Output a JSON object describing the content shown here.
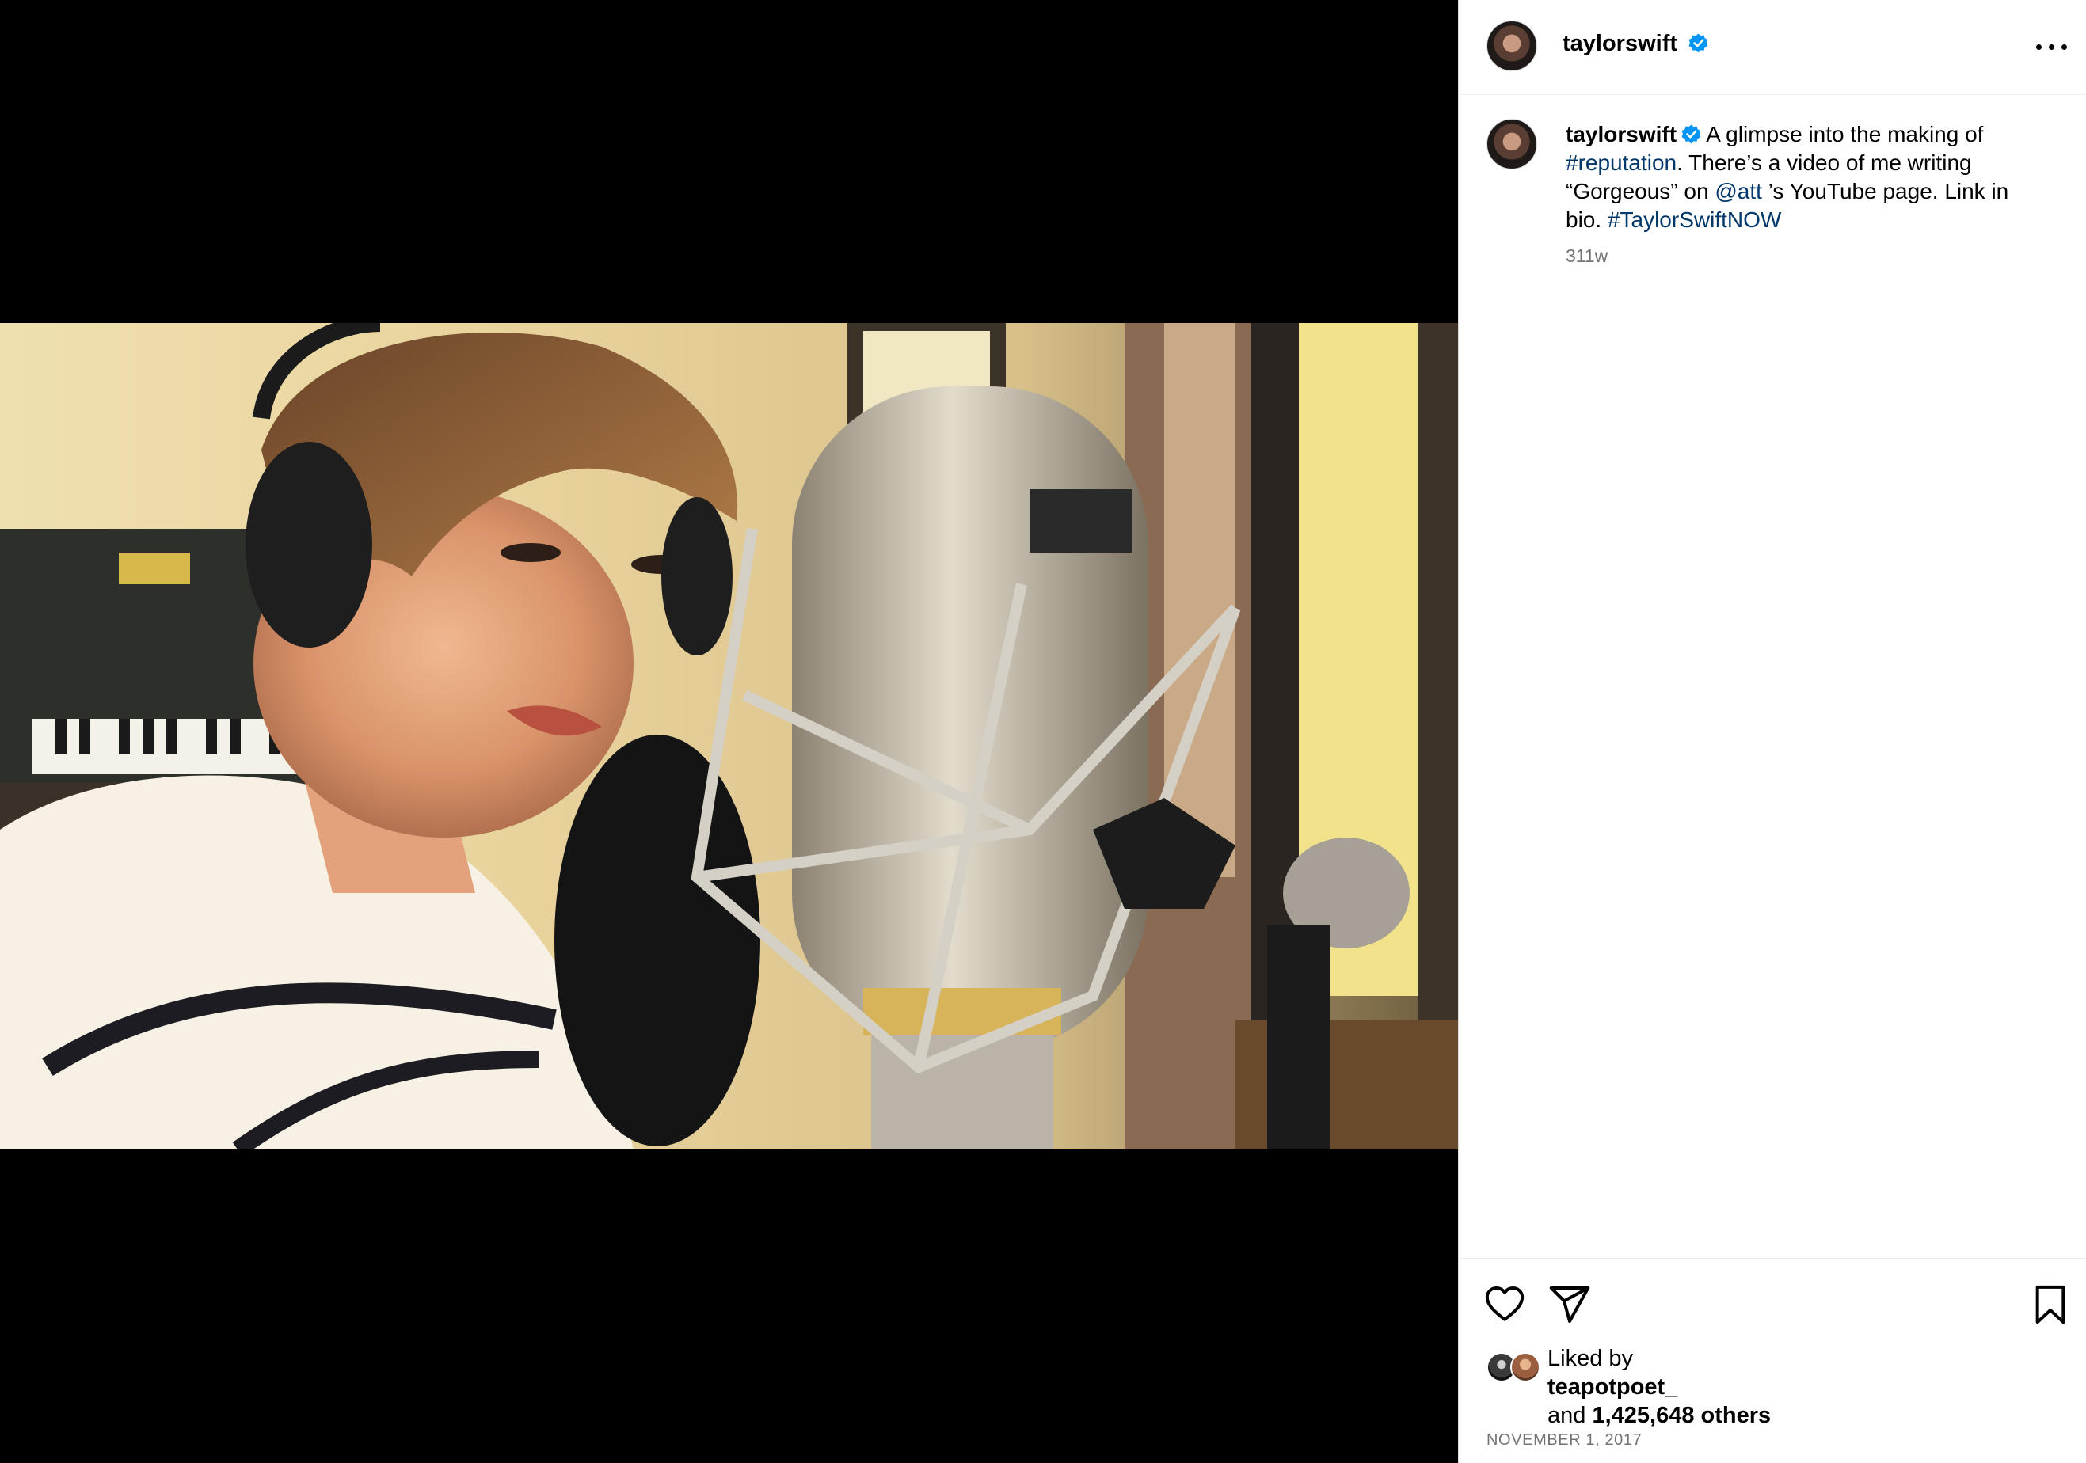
{
  "post": {
    "username": "taylorswift",
    "caption": {
      "username": "taylorswift",
      "text_1": "A glimpse into the making of",
      "hashtag_1": "#reputation",
      "text_2": ". There’s a video of me writing “Gorgeous” on",
      "mention": "@att",
      "text_3": "’s YouTube page. Link in bio.",
      "hashtag_2": "#TaylorSwiftNOW"
    },
    "time_ago": "311w",
    "likes": {
      "liked_by_label": "Liked by",
      "liked_by_user": "teapotpoet_",
      "and_label": "and",
      "others_count": "1,425,648 others"
    },
    "date": "NOVEMBER 1, 2017"
  },
  "icons": {
    "verified": "verified-badge-icon",
    "more": "more-options-icon",
    "like": "heart-icon",
    "share": "paper-plane-icon",
    "save": "bookmark-icon"
  },
  "colors": {
    "link": "#00376b",
    "verified": "#0095f6",
    "muted": "#737373"
  }
}
